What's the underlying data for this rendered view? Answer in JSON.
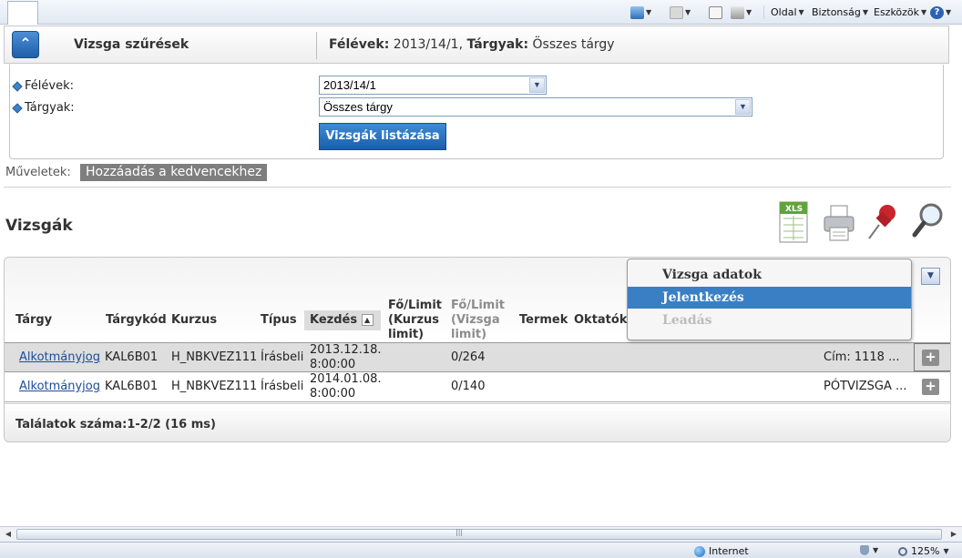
{
  "browser": {
    "menus": [
      "Oldal",
      "Biztonság",
      "Eszközök"
    ],
    "zoom": "125%",
    "zone": "Internet"
  },
  "filter": {
    "title": "Vizsga szűrések",
    "summary_semester_label": "Félévek:",
    "summary_semester_value": "2013/14/1,",
    "summary_subject_label": "Tárgyak:",
    "summary_subject_value": "Összes tárgy",
    "semester_label": "Félévek:",
    "semester_value": "2013/14/1",
    "subject_label": "Tárgyak:",
    "subject_value": "Összes tárgy",
    "list_button": "Vizsgák listázása"
  },
  "operations": {
    "label": "Műveletek:",
    "add_favorite": "Hozzáadás a kedvencekhez"
  },
  "section_title": "Vizsgák",
  "toolbar": {
    "xls_label": "XLS"
  },
  "table": {
    "headers": {
      "subject": "Tárgy",
      "subject_code": "Tárgykód",
      "course": "Kurzus",
      "type": "Típus",
      "start": "Kezdés",
      "limit_course_1": "Fő/Limit",
      "limit_course_2": "(Kurzus",
      "limit_course_3": "limit)",
      "limit_exam_1": "Fő/Limit",
      "limit_exam_2": "(Vizsga",
      "limit_exam_3": "limit)",
      "rooms": "Termek",
      "teachers": "Oktatók"
    },
    "rows": [
      {
        "subject": "Alkotmányjog",
        "code": "KAL6B01",
        "course": "H_NBKVEZ111",
        "type": "Írásbeli",
        "start_date": "2013.12.18.",
        "start_time": "8:00:00",
        "exam_limit": "0/264",
        "note": "Cím: 1118 ..."
      },
      {
        "subject": "Alkotmányjog",
        "code": "KAL6B01",
        "course": "H_NBKVEZ111",
        "type": "Írásbeli",
        "start_date": "2014.01.08.",
        "start_time": "8:00:00",
        "exam_limit": "0/140",
        "note": "PÓTVIZSGA ..."
      }
    ],
    "footer": "Találatok száma:1-2/2 (16 ms)"
  },
  "context_menu": {
    "items": [
      "Vizsga adatok",
      "Jelentkezés",
      "Leadás"
    ]
  }
}
